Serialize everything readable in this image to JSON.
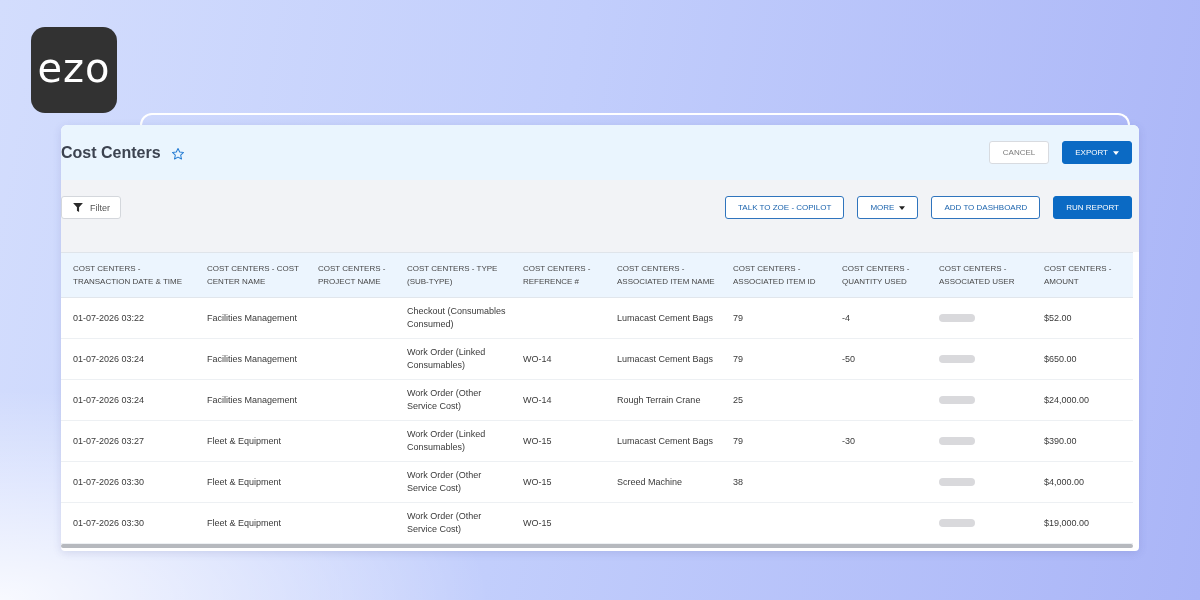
{
  "logo": {
    "text": "ezo"
  },
  "report": {
    "title": "Cost Centers",
    "favorite": false
  },
  "header_buttons": [
    {
      "label": "CANCEL",
      "kind": "secondary",
      "dropdown": false
    },
    {
      "label": "EXPORT",
      "kind": "primary",
      "dropdown": true
    }
  ],
  "filter_button": {
    "label": "Filter"
  },
  "toolbar_buttons": [
    {
      "label": "TALK TO ZOE - COPILOT",
      "kind": "outline",
      "dropdown": false
    },
    {
      "label": "MORE",
      "kind": "outline",
      "dropdown": true
    },
    {
      "label": "ADD TO DASHBOARD",
      "kind": "outline",
      "dropdown": false
    },
    {
      "label": "RUN REPORT",
      "kind": "primary",
      "dropdown": false
    }
  ],
  "table": {
    "columns": [
      "COST CENTERS - TRANSACTION DATE & TIME",
      "COST CENTERS - COST CENTER NAME",
      "COST CENTERS - PROJECT NAME",
      "COST CENTERS - TYPE (SUB-TYPE)",
      "COST CENTERS - REFERENCE #",
      "COST CENTERS - ASSOCIATED ITEM NAME",
      "COST CENTERS - ASSOCIATED ITEM ID",
      "COST CENTERS - QUANTITY USED",
      "COST CENTERS - ASSOCIATED USER",
      "COST CENTERS - AMOUNT"
    ],
    "rows": [
      {
        "transaction_date_time": "01-07-2026 03:22",
        "cost_center_name": "Facilities Management",
        "type_sub_type": "Checkout (Consumables Consumed)",
        "associated_item_name": "Lumacast Cement Bags",
        "associated_item_id": "79",
        "quantity_used": "-4",
        "associated_user_redacted": true,
        "amount": "$52.00"
      },
      {
        "transaction_date_time": "01-07-2026 03:24",
        "cost_center_name": "Facilities Management",
        "type_sub_type": "Work Order (Linked Consumables)",
        "reference": "WO-14",
        "associated_item_name": "Lumacast Cement Bags",
        "associated_item_id": "79",
        "quantity_used": "-50",
        "associated_user_redacted": true,
        "amount": "$650.00"
      },
      {
        "transaction_date_time": "01-07-2026 03:24",
        "cost_center_name": "Facilities Management",
        "type_sub_type": "Work Order (Other Service Cost)",
        "reference": "WO-14",
        "associated_item_name": "Rough Terrain Crane",
        "associated_item_id": "25",
        "associated_user_redacted": true,
        "amount": "$24,000.00"
      },
      {
        "transaction_date_time": "01-07-2026 03:27",
        "cost_center_name": "Fleet & Equipment",
        "type_sub_type": "Work Order (Linked Consumables)",
        "reference": "WO-15",
        "associated_item_name": "Lumacast Cement Bags",
        "associated_item_id": "79",
        "quantity_used": "-30",
        "associated_user_redacted": true,
        "amount": "$390.00"
      },
      {
        "transaction_date_time": "01-07-2026 03:30",
        "cost_center_name": "Fleet & Equipment",
        "type_sub_type": "Work Order (Other Service Cost)",
        "reference": "WO-15",
        "associated_item_name": "Screed Machine",
        "associated_item_id": "38",
        "associated_user_redacted": true,
        "amount": "$4,000.00"
      },
      {
        "transaction_date_time": "01-07-2026 03:30",
        "cost_center_name": "Fleet & Equipment",
        "type_sub_type": "Work Order (Other Service Cost)",
        "reference": "WO-15",
        "associated_user_redacted": true,
        "amount": "$19,000.00"
      }
    ]
  }
}
